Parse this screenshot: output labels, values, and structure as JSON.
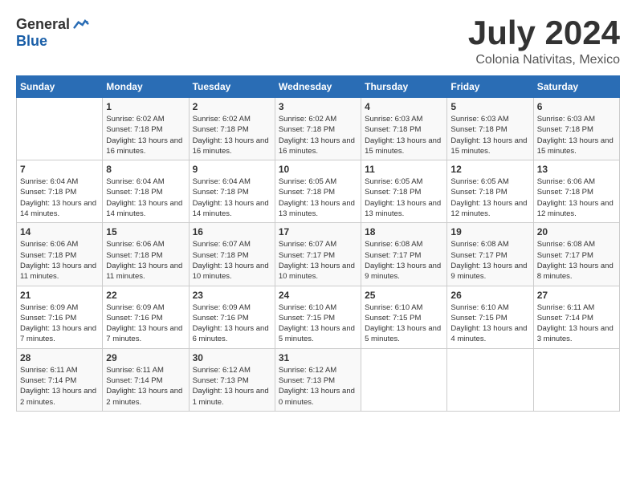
{
  "logo": {
    "general": "General",
    "blue": "Blue"
  },
  "title": {
    "month_year": "July 2024",
    "location": "Colonia Nativitas, Mexico"
  },
  "headers": [
    "Sunday",
    "Monday",
    "Tuesday",
    "Wednesday",
    "Thursday",
    "Friday",
    "Saturday"
  ],
  "weeks": [
    [
      {
        "day": "",
        "sunrise": "",
        "sunset": "",
        "daylight": ""
      },
      {
        "day": "1",
        "sunrise": "Sunrise: 6:02 AM",
        "sunset": "Sunset: 7:18 PM",
        "daylight": "Daylight: 13 hours and 16 minutes."
      },
      {
        "day": "2",
        "sunrise": "Sunrise: 6:02 AM",
        "sunset": "Sunset: 7:18 PM",
        "daylight": "Daylight: 13 hours and 16 minutes."
      },
      {
        "day": "3",
        "sunrise": "Sunrise: 6:02 AM",
        "sunset": "Sunset: 7:18 PM",
        "daylight": "Daylight: 13 hours and 16 minutes."
      },
      {
        "day": "4",
        "sunrise": "Sunrise: 6:03 AM",
        "sunset": "Sunset: 7:18 PM",
        "daylight": "Daylight: 13 hours and 15 minutes."
      },
      {
        "day": "5",
        "sunrise": "Sunrise: 6:03 AM",
        "sunset": "Sunset: 7:18 PM",
        "daylight": "Daylight: 13 hours and 15 minutes."
      },
      {
        "day": "6",
        "sunrise": "Sunrise: 6:03 AM",
        "sunset": "Sunset: 7:18 PM",
        "daylight": "Daylight: 13 hours and 15 minutes."
      }
    ],
    [
      {
        "day": "7",
        "sunrise": "Sunrise: 6:04 AM",
        "sunset": "Sunset: 7:18 PM",
        "daylight": "Daylight: 13 hours and 14 minutes."
      },
      {
        "day": "8",
        "sunrise": "Sunrise: 6:04 AM",
        "sunset": "Sunset: 7:18 PM",
        "daylight": "Daylight: 13 hours and 14 minutes."
      },
      {
        "day": "9",
        "sunrise": "Sunrise: 6:04 AM",
        "sunset": "Sunset: 7:18 PM",
        "daylight": "Daylight: 13 hours and 14 minutes."
      },
      {
        "day": "10",
        "sunrise": "Sunrise: 6:05 AM",
        "sunset": "Sunset: 7:18 PM",
        "daylight": "Daylight: 13 hours and 13 minutes."
      },
      {
        "day": "11",
        "sunrise": "Sunrise: 6:05 AM",
        "sunset": "Sunset: 7:18 PM",
        "daylight": "Daylight: 13 hours and 13 minutes."
      },
      {
        "day": "12",
        "sunrise": "Sunrise: 6:05 AM",
        "sunset": "Sunset: 7:18 PM",
        "daylight": "Daylight: 13 hours and 12 minutes."
      },
      {
        "day": "13",
        "sunrise": "Sunrise: 6:06 AM",
        "sunset": "Sunset: 7:18 PM",
        "daylight": "Daylight: 13 hours and 12 minutes."
      }
    ],
    [
      {
        "day": "14",
        "sunrise": "Sunrise: 6:06 AM",
        "sunset": "Sunset: 7:18 PM",
        "daylight": "Daylight: 13 hours and 11 minutes."
      },
      {
        "day": "15",
        "sunrise": "Sunrise: 6:06 AM",
        "sunset": "Sunset: 7:18 PM",
        "daylight": "Daylight: 13 hours and 11 minutes."
      },
      {
        "day": "16",
        "sunrise": "Sunrise: 6:07 AM",
        "sunset": "Sunset: 7:18 PM",
        "daylight": "Daylight: 13 hours and 10 minutes."
      },
      {
        "day": "17",
        "sunrise": "Sunrise: 6:07 AM",
        "sunset": "Sunset: 7:17 PM",
        "daylight": "Daylight: 13 hours and 10 minutes."
      },
      {
        "day": "18",
        "sunrise": "Sunrise: 6:08 AM",
        "sunset": "Sunset: 7:17 PM",
        "daylight": "Daylight: 13 hours and 9 minutes."
      },
      {
        "day": "19",
        "sunrise": "Sunrise: 6:08 AM",
        "sunset": "Sunset: 7:17 PM",
        "daylight": "Daylight: 13 hours and 9 minutes."
      },
      {
        "day": "20",
        "sunrise": "Sunrise: 6:08 AM",
        "sunset": "Sunset: 7:17 PM",
        "daylight": "Daylight: 13 hours and 8 minutes."
      }
    ],
    [
      {
        "day": "21",
        "sunrise": "Sunrise: 6:09 AM",
        "sunset": "Sunset: 7:16 PM",
        "daylight": "Daylight: 13 hours and 7 minutes."
      },
      {
        "day": "22",
        "sunrise": "Sunrise: 6:09 AM",
        "sunset": "Sunset: 7:16 PM",
        "daylight": "Daylight: 13 hours and 7 minutes."
      },
      {
        "day": "23",
        "sunrise": "Sunrise: 6:09 AM",
        "sunset": "Sunset: 7:16 PM",
        "daylight": "Daylight: 13 hours and 6 minutes."
      },
      {
        "day": "24",
        "sunrise": "Sunrise: 6:10 AM",
        "sunset": "Sunset: 7:15 PM",
        "daylight": "Daylight: 13 hours and 5 minutes."
      },
      {
        "day": "25",
        "sunrise": "Sunrise: 6:10 AM",
        "sunset": "Sunset: 7:15 PM",
        "daylight": "Daylight: 13 hours and 5 minutes."
      },
      {
        "day": "26",
        "sunrise": "Sunrise: 6:10 AM",
        "sunset": "Sunset: 7:15 PM",
        "daylight": "Daylight: 13 hours and 4 minutes."
      },
      {
        "day": "27",
        "sunrise": "Sunrise: 6:11 AM",
        "sunset": "Sunset: 7:14 PM",
        "daylight": "Daylight: 13 hours and 3 minutes."
      }
    ],
    [
      {
        "day": "28",
        "sunrise": "Sunrise: 6:11 AM",
        "sunset": "Sunset: 7:14 PM",
        "daylight": "Daylight: 13 hours and 2 minutes."
      },
      {
        "day": "29",
        "sunrise": "Sunrise: 6:11 AM",
        "sunset": "Sunset: 7:14 PM",
        "daylight": "Daylight: 13 hours and 2 minutes."
      },
      {
        "day": "30",
        "sunrise": "Sunrise: 6:12 AM",
        "sunset": "Sunset: 7:13 PM",
        "daylight": "Daylight: 13 hours and 1 minute."
      },
      {
        "day": "31",
        "sunrise": "Sunrise: 6:12 AM",
        "sunset": "Sunset: 7:13 PM",
        "daylight": "Daylight: 13 hours and 0 minutes."
      },
      {
        "day": "",
        "sunrise": "",
        "sunset": "",
        "daylight": ""
      },
      {
        "day": "",
        "sunrise": "",
        "sunset": "",
        "daylight": ""
      },
      {
        "day": "",
        "sunrise": "",
        "sunset": "",
        "daylight": ""
      }
    ]
  ]
}
